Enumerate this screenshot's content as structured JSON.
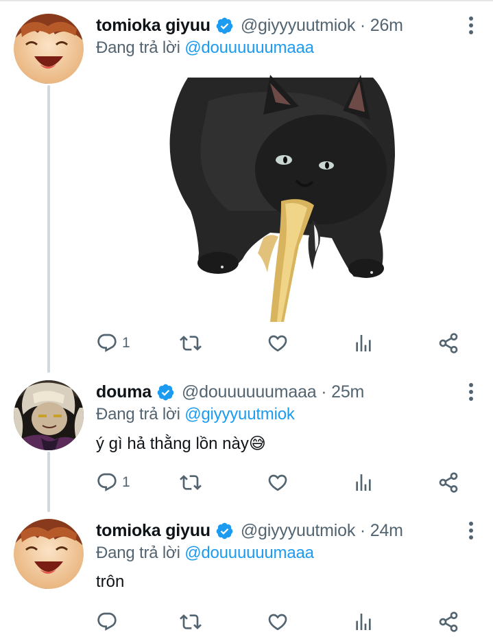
{
  "tweets": [
    {
      "display_name": "tomioka giyuu",
      "handle_time": "@giyyyuutmiok · 26m",
      "replying_prefix": "Đang trả lời ",
      "replying_to": "@douuuuuumaaa",
      "text": "",
      "has_media": true,
      "reply_count": "1"
    },
    {
      "display_name": "douma",
      "handle_time": "@douuuuuumaaa · 25m",
      "replying_prefix": "Đang trả lời ",
      "replying_to": "@giyyyuutmiok",
      "text": "ý gì hả thằng lồn này😅",
      "has_media": false,
      "reply_count": "1"
    },
    {
      "display_name": "tomioka giyuu",
      "handle_time": "@giyyyuutmiok · 24m",
      "replying_prefix": "Đang trả lời ",
      "replying_to": "@douuuuuumaaa",
      "text": "trôn",
      "has_media": false,
      "reply_count": ""
    }
  ],
  "icons": {
    "reply": "reply-icon",
    "retweet": "retweet-icon",
    "like": "heart-icon",
    "analytics": "analytics-icon",
    "share": "share-icon",
    "verified": "verified-badge-icon",
    "more": "more-vertical-icon"
  },
  "colors": {
    "accent": "#1d9bf0",
    "secondary_text": "#536471",
    "primary_text": "#0f1419",
    "icon": "#536471",
    "thread_line": "#cfd9de"
  }
}
